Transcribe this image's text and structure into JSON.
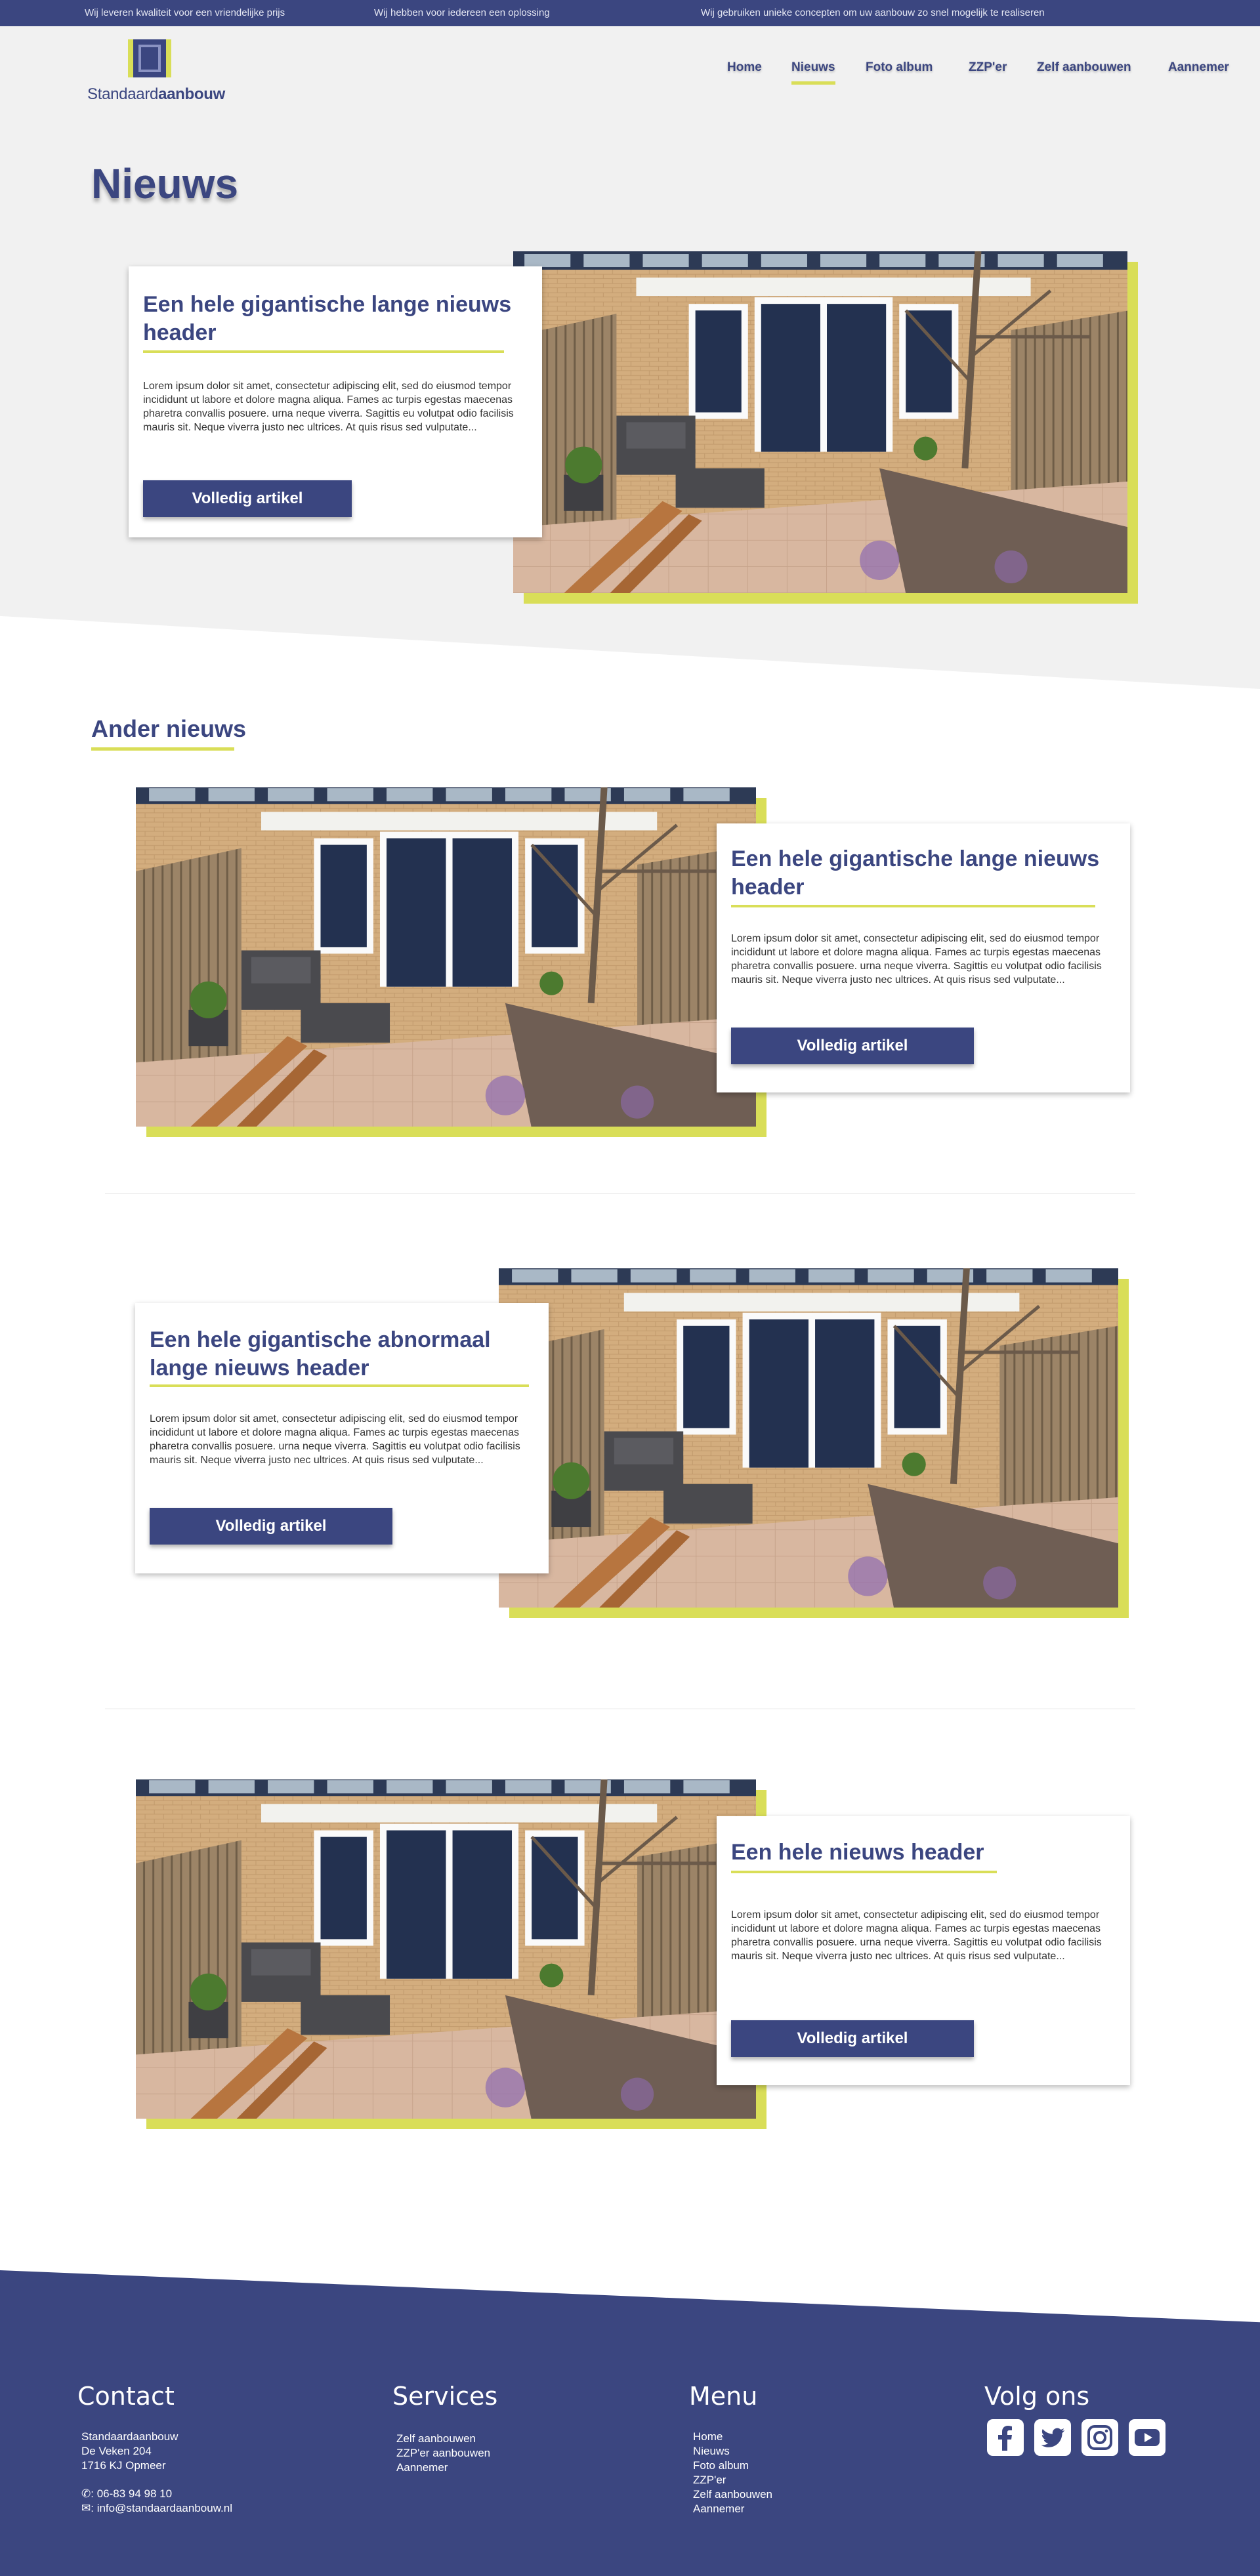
{
  "topbar": {
    "items": [
      "Wij leveren kwaliteit voor een vriendelijke prijs",
      "Wij hebben voor iedereen een oplossing",
      "Wij gebruiken unieke concepten om uw aanbouw zo snel mogelijk te realiseren"
    ]
  },
  "brand": {
    "light": "Standaard",
    "bold": "aanbouw"
  },
  "nav": [
    {
      "label": "Home",
      "active": false
    },
    {
      "label": "Nieuws",
      "active": true
    },
    {
      "label": "Foto album",
      "active": false
    },
    {
      "label": "ZZP'er",
      "active": false
    },
    {
      "label": "Zelf aanbouwen",
      "active": false
    },
    {
      "label": "Aannemer",
      "active": false
    }
  ],
  "page_title": "Nieuws",
  "featured": {
    "title": "Een hele gigantische lange nieuws header",
    "body": "Lorem ipsum dolor sit amet, consectetur adipiscing elit, sed do eiusmod tempor incididunt ut labore et dolore magna aliqua. Fames ac turpis egestas maecenas pharetra convallis posuere. urna neque viverra. Sagittis eu volutpat odio facilisis mauris sit. Neque viverra justo nec ultrices. At quis risus sed vulputate...",
    "button": "Volledig artikel"
  },
  "other_news_title": "Ander nieuws",
  "articles": [
    {
      "title": "Een hele gigantische lange nieuws header",
      "body": "Lorem ipsum dolor sit amet, consectetur adipiscing elit, sed do eiusmod tempor incididunt ut labore et dolore magna aliqua. Fames ac turpis egestas maecenas pharetra convallis posuere. urna neque viverra. Sagittis eu volutpat odio facilisis mauris sit. Neque viverra justo nec ultrices. At quis risus sed vulputate...",
      "button": "Volledig artikel"
    },
    {
      "title": "Een hele gigantische abnormaal lange nieuws header",
      "body": "Lorem ipsum dolor sit amet, consectetur adipiscing elit, sed do eiusmod tempor incididunt ut labore et dolore magna aliqua. Fames ac turpis egestas maecenas pharetra convallis posuere. urna neque viverra. Sagittis eu volutpat odio facilisis mauris sit. Neque viverra justo nec ultrices. At quis risus sed vulputate...",
      "button": "Volledig artikel"
    },
    {
      "title": "Een hele nieuws header",
      "body": "Lorem ipsum dolor sit amet, consectetur adipiscing elit, sed do eiusmod tempor incididunt ut labore et dolore magna aliqua. Fames ac turpis egestas maecenas pharetra convallis posuere. urna neque viverra. Sagittis eu volutpat odio facilisis mauris sit. Neque viverra justo nec ultrices. At quis risus sed vulputate...",
      "button": "Volledig artikel"
    }
  ],
  "footer": {
    "contact": {
      "title": "Contact",
      "lines": [
        "Standaardaanbouw",
        "De Veken 204",
        "1716 KJ Opmeer"
      ],
      "phone": ": 06-83 94 98 10",
      "email": ": info@standaardaanbouw.nl"
    },
    "services": {
      "title": "Services",
      "items": [
        "Zelf aanbouwen",
        "ZZP'er aanbouwen",
        "Aannemer"
      ]
    },
    "menu": {
      "title": "Menu",
      "items": [
        "Home",
        "Nieuws",
        "Foto album",
        "ZZP'er",
        "Zelf aanbouwen",
        "Aannemer"
      ]
    },
    "social": {
      "title": "Volg ons",
      "icons": [
        "facebook-icon",
        "twitter-icon",
        "instagram-icon",
        "youtube-icon"
      ]
    }
  },
  "colors": {
    "primary": "#3b4680",
    "accent": "#d9de58",
    "background": "#f1f1f1"
  }
}
